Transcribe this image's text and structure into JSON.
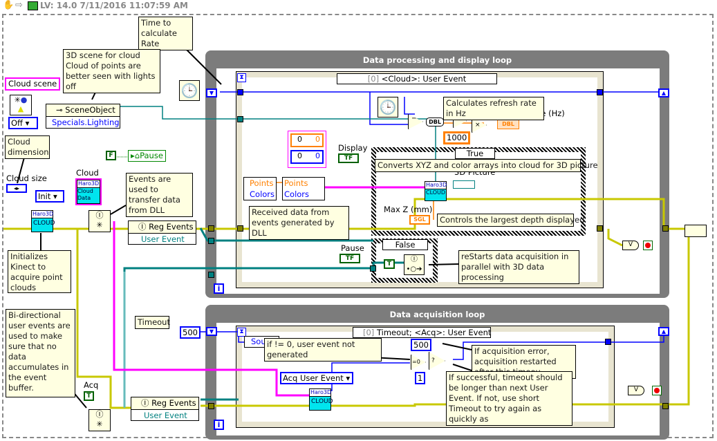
{
  "header": {
    "version_text": "LV: 14.0 7/11/2016 11:07:59 AM",
    "icons": [
      "hand-icon",
      "run-arrow-icon",
      "vi-icon"
    ]
  },
  "loops": {
    "processing": {
      "title": "Data processing and display loop",
      "event_selector_index": "[0]",
      "event_selector": "<Cloud>: User Event",
      "true_case": "True",
      "false_case": "False"
    },
    "acquisition": {
      "title": "Data acquisition loop",
      "event_selector_index": "[0]",
      "event_selector": "Timeout;  <Acq>: User Event"
    }
  },
  "notes": {
    "time_rate": "Time to calculate Rate",
    "scene": "3D scene for cloud Cloud of points are better seen with lights off",
    "cloud_dimension": "Cloud dimension",
    "init_kinect": "Initializes Kinect to acquire point clouds",
    "events_dll": "Events are used to transfer data from DLL",
    "refresh_calc": "Calculates refresh rate in Hz",
    "received": "Received data from events generated by DLL",
    "converts": "Converts XYZ and color arrays into cloud for 3D picture",
    "max_depth": "Controls the largest depth displayed",
    "restarts": "reStarts data acquisition in parallel with 3D data processing",
    "bidirectional": "Bi-directional user events are used to make sure that no data accumulates in the event buffer.",
    "timeout_label": "Timeout",
    "if_not_zero": "if != 0, user event not generated",
    "acq_error": "If acquisition error, acquisition restarted after this timeou",
    "if_success": "If successful, timeout should be longer than next User Event. If not, use short Timeout to try again as quickly as"
  },
  "labels": {
    "cloud_scene": "Cloud scene",
    "cloud_size": "Cloud size",
    "cloud": "Cloud",
    "cloud_cluster": "Cloud",
    "refresh_rate": "Refresh rate (Hz)",
    "display": "Display",
    "picture": "3D Picture",
    "max_z": "Max Z (mm)",
    "pause": "Pause",
    "acq": "Acq",
    "pause_local": "Pause"
  },
  "nodes": {
    "scene_object": "SceneObject",
    "lighting": "Specials.Lighting",
    "lighting_value": "Off",
    "init_value": "Init",
    "reg_events": "Reg Events",
    "user_event": "User Event",
    "acq_user_event": "Acq User Event",
    "source": "Source",
    "points": "Points",
    "colors": "Colors",
    "dbl": "DBL",
    "sgl": "SGL",
    "const_1000": "1000",
    "const_500": "500",
    "const_500b": "500",
    "const_1": "1",
    "cluster_vals": [
      "0",
      "0",
      "0",
      "0"
    ],
    "bool_f": "F",
    "bool_t": "T",
    "tf": "TF",
    "haro": "Haro3D",
    "cloud_word": "CLOUD",
    "cloud_data": "Cloud Data",
    "iter": "i"
  },
  "colors": {
    "error_wire": "#c8c800",
    "int_wire": "#0000ff",
    "refnum_wire": "#008080",
    "cluster_wire": "#ff00ff",
    "float_wire": "#ff8000",
    "bool_wire": "#008000",
    "loop_frame": "#7c7c7c",
    "note_bg": "#ffffe1"
  }
}
